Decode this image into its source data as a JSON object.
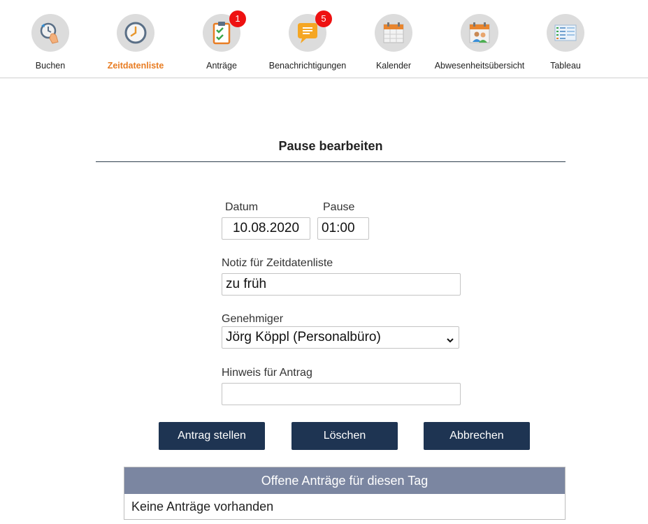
{
  "nav": {
    "items": [
      {
        "label": "Buchen",
        "icon": "booking-clock-icon",
        "badge": ""
      },
      {
        "label": "Zeitdatenliste",
        "icon": "clock-icon",
        "badge": ""
      },
      {
        "label": "Anträge",
        "icon": "clipboard-check-icon",
        "badge": "1"
      },
      {
        "label": "Benachrichtigungen",
        "icon": "message-bubble-icon",
        "badge": "5"
      },
      {
        "label": "Kalender",
        "icon": "calendar-icon",
        "badge": ""
      },
      {
        "label": "Abwesenheitsübersicht",
        "icon": "absence-people-icon",
        "badge": ""
      },
      {
        "label": "Tableau",
        "icon": "table-grid-icon",
        "badge": ""
      }
    ],
    "active_index": 1,
    "active_color": "#e87c22",
    "badge_color": "#ee1111"
  },
  "page": {
    "title": "Pause bearbeiten"
  },
  "form": {
    "datum_label": "Datum",
    "datum_value": "10.08.2020",
    "pause_label": "Pause",
    "pause_value": "01:00",
    "notiz_label": "Notiz für Zeitdatenliste",
    "notiz_value": "zu früh",
    "genehmiger_label": "Genehmiger",
    "genehmiger_value": "Jörg Köppl (Personalbüro)",
    "hinweis_label": "Hinweis für Antrag",
    "hinweis_value": ""
  },
  "buttons": {
    "submit": "Antrag stellen",
    "delete": "Löschen",
    "cancel": "Abbrechen",
    "color": "#1e3452"
  },
  "open_requests": {
    "header": "Offene Anträge für diesen Tag",
    "empty_text": "Keine Anträge vorhanden",
    "header_color": "#7b86a1"
  }
}
